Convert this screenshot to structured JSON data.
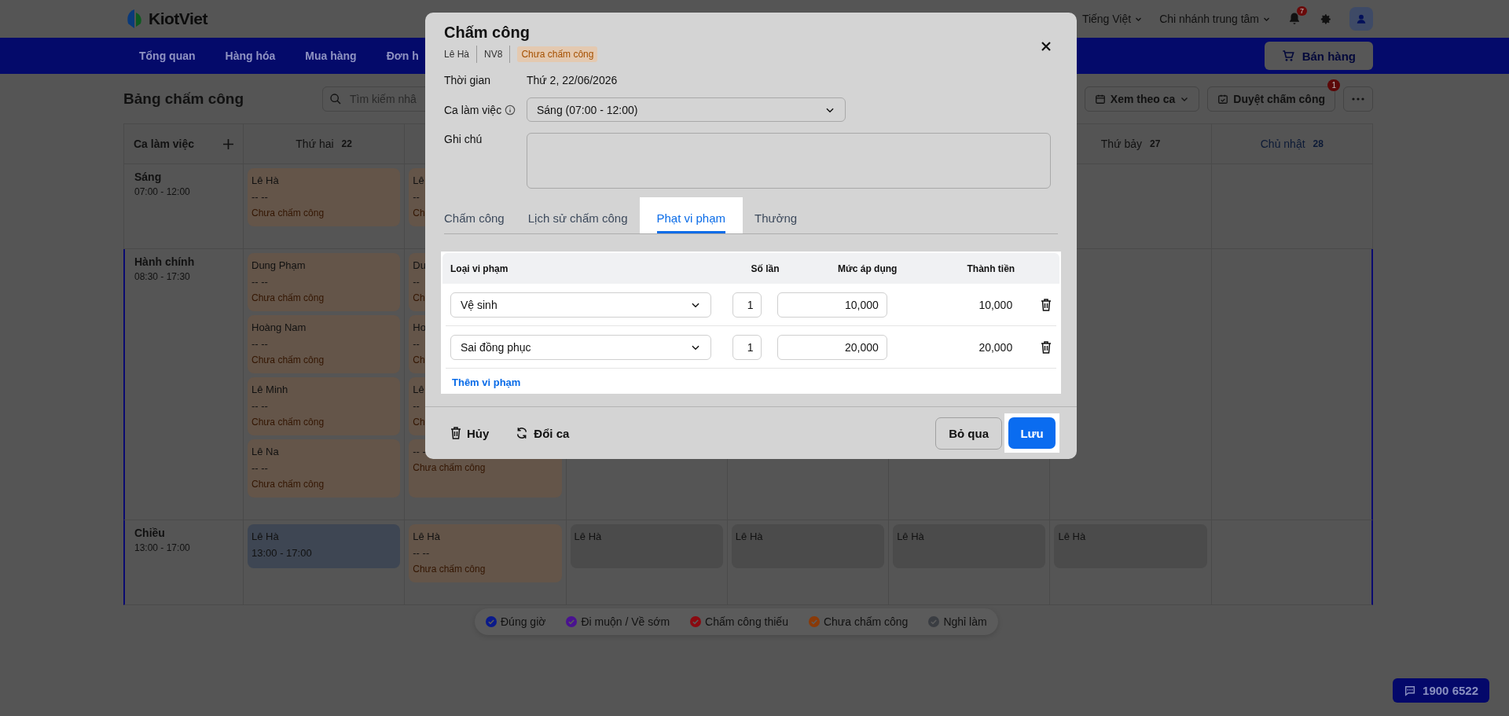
{
  "header": {
    "logo": "KiotViet",
    "language": "Tiếng Việt",
    "branch": "Chi nhánh trung tâm",
    "notification_count": "7"
  },
  "nav": {
    "items": [
      {
        "label": "Tổng quan"
      },
      {
        "label": "Hàng hóa"
      },
      {
        "label": "Mua hàng"
      },
      {
        "label": "Đơn h"
      }
    ],
    "sell_button": "Bán hàng"
  },
  "toolbar": {
    "title": "Bảng chấm công",
    "search": {
      "placeholder": "Tìm kiếm nhâ"
    },
    "view_button": "Xem theo ca",
    "approve_button": "Duyệt chấm công",
    "approve_badge": "1"
  },
  "calendar": {
    "corner_label": "Ca làm việc",
    "days_left": [
      {
        "name": "Thứ hai",
        "date": "22",
        "muted": false
      }
    ],
    "days_right": [
      {
        "name": "Thứ bảy",
        "date": "27",
        "muted": false
      },
      {
        "name": "Chủ nhật",
        "date": "28",
        "muted": true
      }
    ],
    "shifts": [
      {
        "name": "Sáng",
        "time": "07:00 - 12:00",
        "selected": false,
        "cells": [
          [
            {
              "kind": "pending",
              "name": "Lê Hà",
              "time": "-- --",
              "note": "Chưa chấm công"
            }
          ],
          [
            {
              "kind": "pending",
              "name": "Lê",
              "time": "--",
              "note": "Ch"
            }
          ],
          [],
          [],
          [],
          [],
          []
        ]
      },
      {
        "name": "Hành chính",
        "time": "08:30 - 17:30",
        "selected": true,
        "cells": [
          [
            {
              "kind": "pending",
              "name": "Dung Phạm",
              "time": "-- --",
              "note": "Chưa chấm công"
            },
            {
              "kind": "pending",
              "name": "Hoàng Nam",
              "time": "-- --",
              "note": "Chưa chấm công"
            },
            {
              "kind": "pending",
              "name": "Lê Minh",
              "time": "-- --",
              "note": "Chưa chấm công"
            },
            {
              "kind": "pending",
              "name": "Lê Na",
              "time": "-- --",
              "note": "Chưa chấm công"
            }
          ],
          [
            {
              "kind": "pending",
              "name": "Du",
              "time": "--",
              "note": "Ch"
            },
            {
              "kind": "pending",
              "name": "Ho",
              "time": "--",
              "note": "Ch"
            },
            {
              "kind": "pending",
              "name": "Lê",
              "time": "--",
              "note": "Ch"
            },
            {
              "kind": "pending",
              "time": "-- --",
              "note": "Chưa chấm công"
            }
          ],
          [],
          [],
          [],
          [],
          []
        ]
      },
      {
        "name": "Chiều",
        "time": "13:00 - 17:00",
        "selected": true,
        "cells": [
          [
            {
              "kind": "checked",
              "name": "Lê Hà",
              "time": "13:00 - 17:00"
            }
          ],
          [
            {
              "kind": "pending",
              "name": "Lê Hà",
              "time": "-- --",
              "note": "Chưa chấm công"
            }
          ],
          [
            {
              "kind": "scheduled",
              "name": "Lê Hà"
            }
          ],
          [
            {
              "kind": "scheduled",
              "name": "Lê Hà"
            }
          ],
          [
            {
              "kind": "scheduled",
              "name": "Lê Hà"
            }
          ],
          [
            {
              "kind": "scheduled",
              "name": "Lê Hà"
            }
          ],
          []
        ]
      }
    ]
  },
  "legend": [
    {
      "label": "Đúng giờ",
      "color": "#0a1a8a"
    },
    {
      "label": "Đi muộn / Về sớm",
      "color": "#4a1290"
    },
    {
      "label": "Chấm công thiếu",
      "color": "#8a0a10"
    },
    {
      "label": "Chưa chấm công",
      "color": "#8a3a08"
    },
    {
      "label": "Nghỉ làm",
      "color": "#3a3d42"
    }
  ],
  "hotline": "1900 6522",
  "modal": {
    "title": "Chấm công",
    "employee": "Lê Hà",
    "code": "NV8",
    "status": "Chưa chấm công",
    "time_label": "Thời gian",
    "time_value": "Thứ 2, 22/06/2026",
    "shift_label": "Ca làm việc",
    "shift_value": "Sáng (07:00 - 12:00)",
    "note_label": "Ghi chú",
    "tabs": [
      {
        "label": "Chấm công",
        "selected": false
      },
      {
        "label": "Lịch sử chấm công",
        "selected": false
      },
      {
        "label": "Phạt vi phạm",
        "selected": true
      },
      {
        "label": "Thưởng",
        "selected": false
      }
    ],
    "table": {
      "columns": [
        "Loại vi phạm",
        "Số lần",
        "Mức áp dụng",
        "Thành tiền"
      ],
      "rows": [
        {
          "type": "Vệ sinh",
          "count": "1",
          "rate": "10,000",
          "amount": "10,000"
        },
        {
          "type": "Sai đồng phục",
          "count": "1",
          "rate": "20,000",
          "amount": "20,000"
        }
      ],
      "add_link": "Thêm vi phạm"
    },
    "footer": {
      "delete": "Hủy",
      "swap": "Đổi ca",
      "skip": "Bỏ qua",
      "save": "Lưu"
    }
  }
}
